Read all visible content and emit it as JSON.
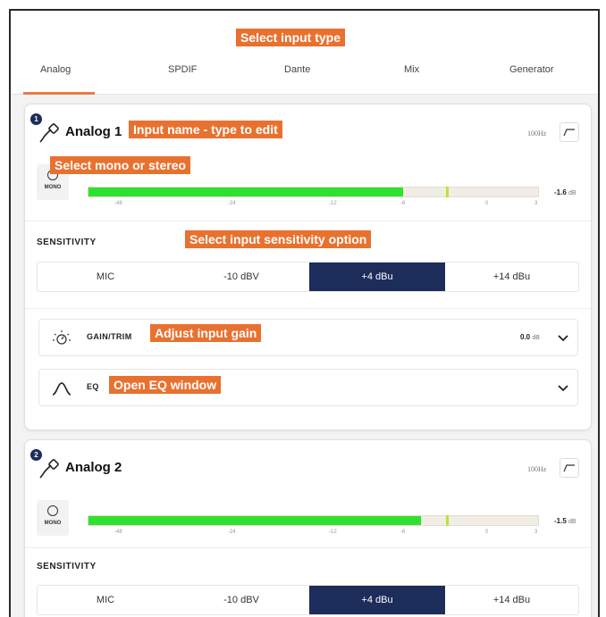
{
  "tabs": {
    "items": [
      "Analog",
      "SPDIF",
      "Dante",
      "Mix",
      "Generator"
    ],
    "active": "Analog"
  },
  "channels": [
    {
      "number": "1",
      "name": "Analog 1",
      "hp_freq": "100Hz",
      "mono_label": "MONO",
      "meter": {
        "level_db": "-1.6",
        "unit": "dB",
        "fill_fraction": 0.7,
        "peak_fraction": 0.795
      },
      "ticks": [
        "-48",
        "-24",
        "-12",
        "-6",
        "0",
        "3"
      ],
      "sensitivity_label": "SENSITIVITY",
      "sensitivity_options": [
        "MIC",
        "-10 dBV",
        "+4 dBu",
        "+14 dBu"
      ],
      "sensitivity_selected": "+4 dBu",
      "gain": {
        "label": "GAIN/TRIM",
        "value": "0.0",
        "unit": "dB"
      },
      "eq": {
        "label": "EQ"
      }
    },
    {
      "number": "2",
      "name": "Analog 2",
      "hp_freq": "100Hz",
      "mono_label": "MONO",
      "meter": {
        "level_db": "-1.5",
        "unit": "dB",
        "fill_fraction": 0.74,
        "peak_fraction": 0.795
      },
      "ticks": [
        "-48",
        "-24",
        "-12",
        "-6",
        "0",
        "3"
      ],
      "sensitivity_label": "SENSITIVITY",
      "sensitivity_options": [
        "MIC",
        "-10 dBV",
        "+4 dBu",
        "+14 dBu"
      ],
      "sensitivity_selected": "+4 dBu"
    }
  ],
  "annotations": {
    "input_type": "Select input type",
    "input_name": "Input name - type to edit",
    "mono_stereo": "Select mono or stereo",
    "sensitivity": "Select input sensitivity option",
    "gain": "Adjust input gain",
    "eq": "Open EQ window"
  },
  "colors": {
    "accent": "#e8712f",
    "tab_underline": "#e87a45",
    "selected": "#1c2c5b",
    "meter_green": "#2fe12f",
    "meter_peak": "#b7e43a"
  },
  "icons": [
    "mic-cable-icon",
    "high-pass-filter-icon",
    "mono-circle-icon",
    "gain-knob-icon",
    "eq-curve-icon",
    "chevron-down-icon"
  ]
}
